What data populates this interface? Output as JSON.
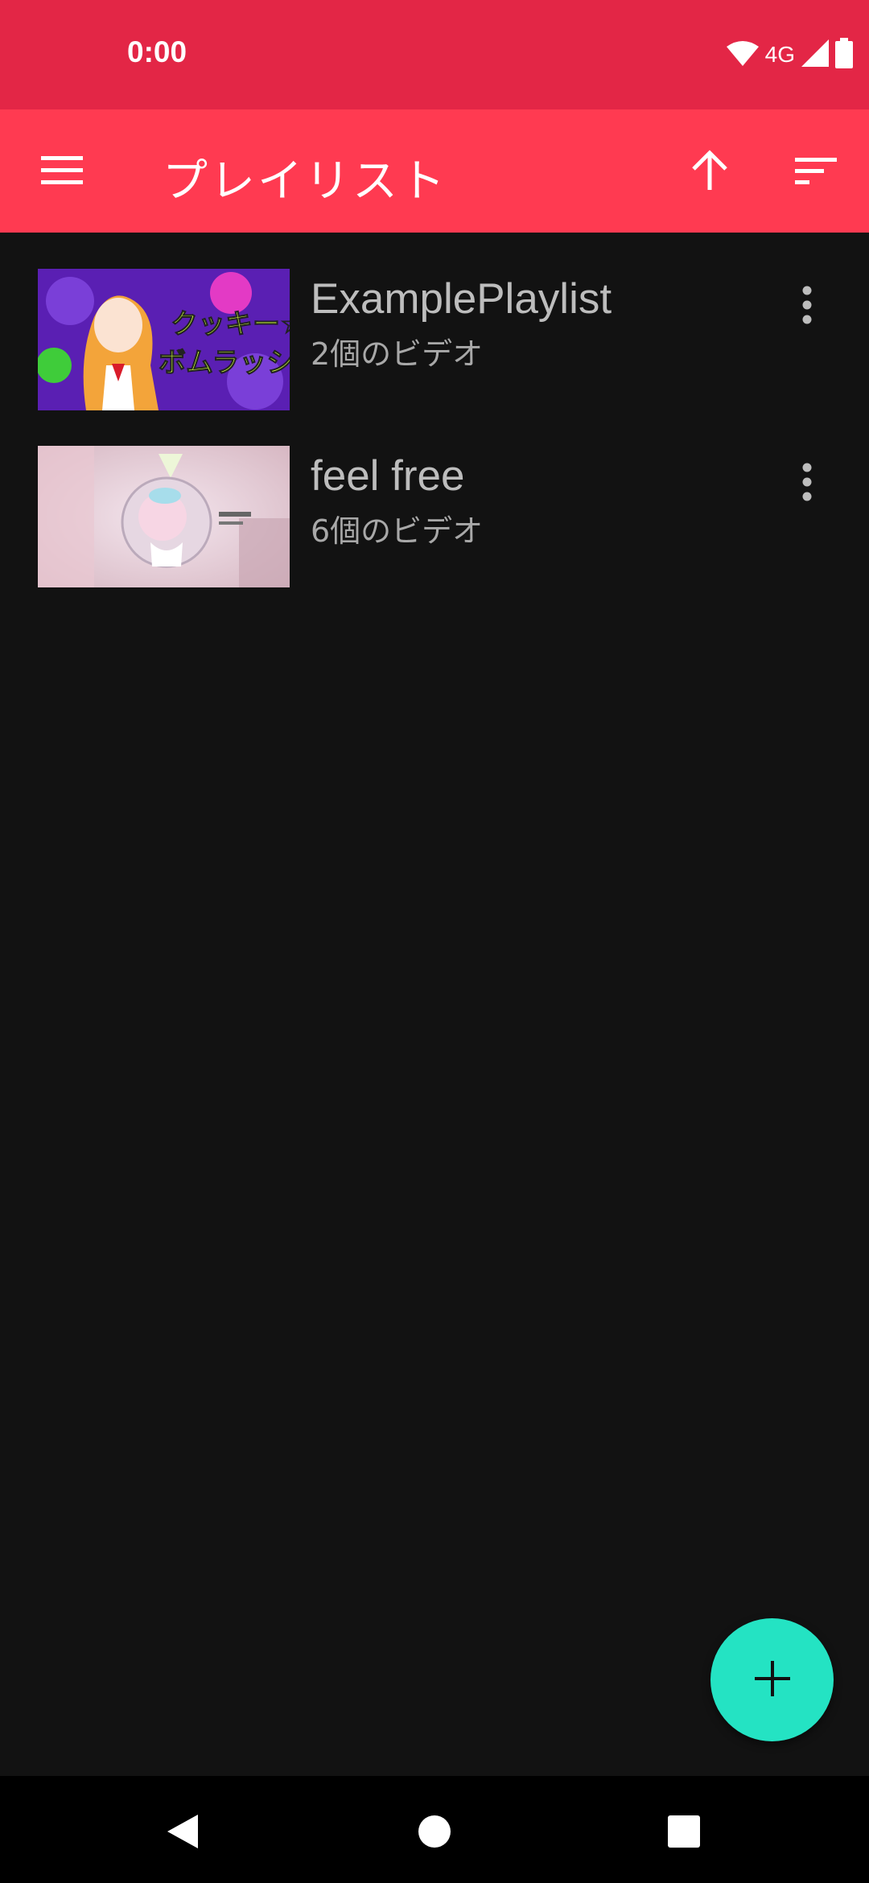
{
  "status_bar": {
    "time": "0:00",
    "network": "4G",
    "icons": [
      "wifi-icon",
      "signal-icon",
      "battery-icon"
    ]
  },
  "toolbar": {
    "title": "プレイリスト",
    "menu_icon": "hamburger-menu-icon",
    "sort_direction_icon": "arrow-up-icon",
    "sort_icon": "sort-icon"
  },
  "playlists": [
    {
      "title": "ExamplePlaylist",
      "count": "2個のビデオ",
      "thumb_text_line1": "クッキー☆",
      "thumb_text_line2": "ボムラッシュ"
    },
    {
      "title": "feel free",
      "count": "6個のビデオ"
    }
  ],
  "fab": {
    "icon": "plus-icon"
  },
  "nav_bar": {
    "icons": [
      "back-icon",
      "home-icon",
      "recents-icon"
    ]
  },
  "colors": {
    "status_bar": "#E32646",
    "toolbar": "#FF3A51",
    "background": "#121212",
    "fab": "#24E3C3"
  }
}
